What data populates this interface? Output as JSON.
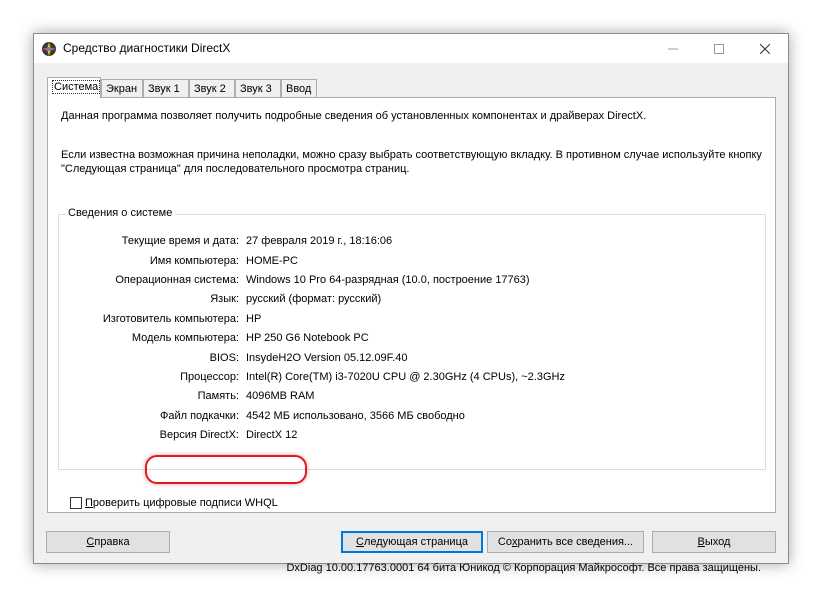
{
  "window": {
    "title": "Средство диагностики DirectX"
  },
  "tabs": [
    "Система",
    "Экран",
    "Звук 1",
    "Звук 2",
    "Звук 3",
    "Ввод"
  ],
  "description": {
    "line1": "Данная программа позволяет получить подробные сведения об установленных компонентах и драйверах DirectX.",
    "line2": "Если известна возможная причина неполадки, можно сразу выбрать соответствующую вкладку. В противном случае используйте кнопку \"Следующая страница\" для последовательного просмотра страниц."
  },
  "system_info": {
    "group_label": "Сведения о системе",
    "rows": [
      {
        "label": "Текущие время и дата:",
        "value": "27 февраля 2019 г., 18:16:06"
      },
      {
        "label": "Имя компьютера:",
        "value": "HOME-PC"
      },
      {
        "label": "Операционная система:",
        "value": "Windows 10 Pro 64-разрядная (10.0, построение 17763)"
      },
      {
        "label": "Язык:",
        "value": "русский (формат: русский)"
      },
      {
        "label": "Изготовитель компьютера:",
        "value": "HP"
      },
      {
        "label": "Модель компьютера:",
        "value": "HP 250 G6 Notebook PC"
      },
      {
        "label": "BIOS:",
        "value": "InsydeH2O Version 05.12.09F.40"
      },
      {
        "label": "Процессор:",
        "value": "Intel(R) Core(TM) i3-7020U CPU @ 2.30GHz (4 CPUs), ~2.3GHz"
      },
      {
        "label": "Память:",
        "value": "4096MB RAM"
      },
      {
        "label": "Файл подкачки:",
        "value": "4542 МБ использовано, 3566 МБ свободно"
      },
      {
        "label": "Версия DirectX:",
        "value": "DirectX 12"
      }
    ]
  },
  "whql": {
    "first_letter": "П",
    "rest": "роверить цифровые подписи WHQL",
    "checked": false
  },
  "footer": "DxDiag 10.00.17763.0001 64 бита Юникод © Корпорация Майкрософт. Все права защищены.",
  "buttons": {
    "help": {
      "u": "С",
      "rest": "правка"
    },
    "next": {
      "u": "С",
      "rest": "ледующая страница"
    },
    "save": {
      "pre": "Со",
      "u": "х",
      "rest": "ранить все сведения..."
    },
    "exit": {
      "u": "В",
      "rest": "ыход"
    }
  },
  "colors": {
    "highlight": "#e01b1b",
    "accent": "#0078d7"
  }
}
